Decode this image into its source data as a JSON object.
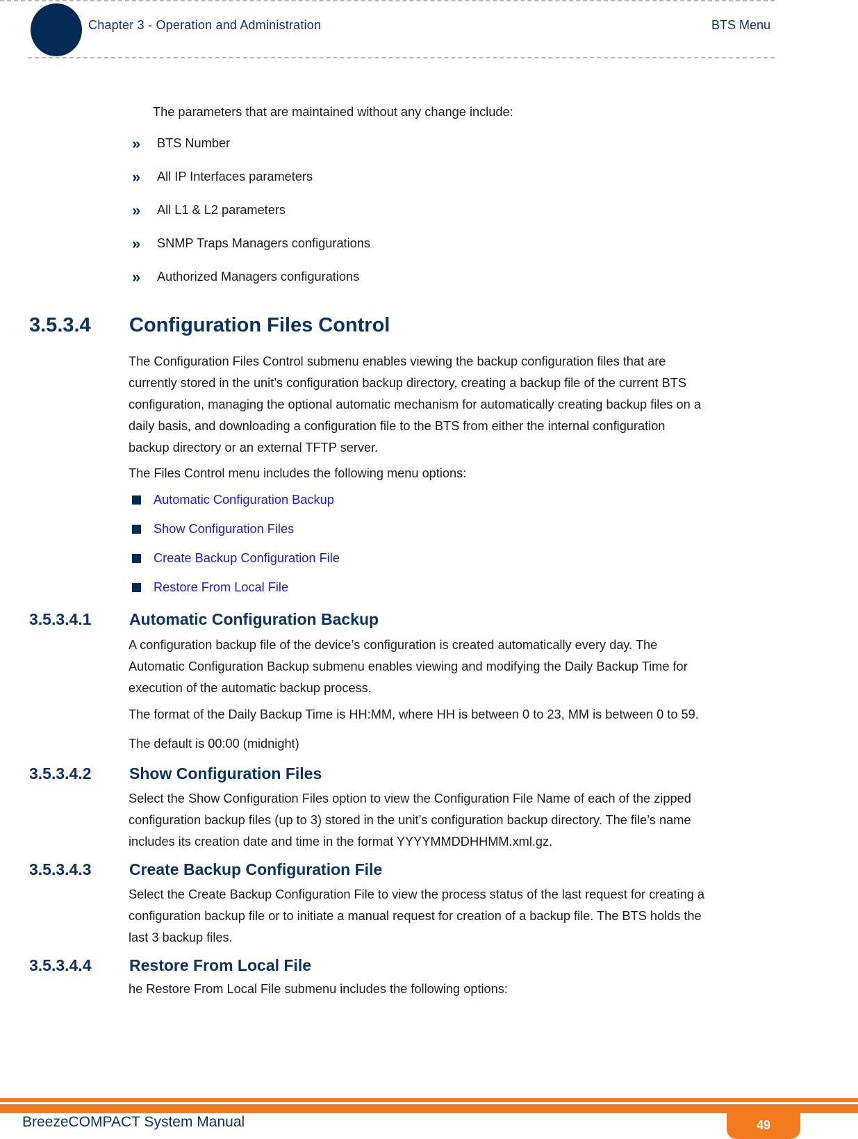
{
  "header": {
    "chapter": "Chapter 3 - Operation and Administration",
    "section": "BTS Menu"
  },
  "intro": {
    "text": "The parameters that are maintained without any change include:",
    "items": [
      "BTS Number",
      "All IP Interfaces parameters",
      "All L1 & L2 parameters",
      "SNMP Traps Managers configurations",
      "Authorized Managers configurations"
    ]
  },
  "s3534": {
    "num": "3.5.3.4",
    "title": "Configuration Files Control",
    "p1_lines": [
      "The Configuration Files Control submenu enables viewing the backup configuration files that are",
      "currently stored in the unit’s configuration backup directory, creating a backup file of the current BTS",
      "configuration, managing the optional automatic mechanism for automatically creating backup files on a",
      "daily basis, and downloading a configuration file to the BTS from either the internal configuration",
      "backup directory or an external TFTP server."
    ],
    "p2": "The Files Control menu includes the following menu options:",
    "links": [
      "Automatic Configuration Backup",
      "Show Configuration Files",
      "Create Backup Configuration File",
      "Restore From Local File"
    ]
  },
  "s35341": {
    "num": "3.5.3.4.1",
    "title": "Automatic Configuration Backup",
    "p1_lines": [
      "A configuration backup file of the device’s configuration is created automatically every day. The",
      "Automatic Configuration Backup submenu enables viewing and modifying the Daily Backup Time for",
      "execution of the automatic backup process."
    ],
    "p2": "The format of the Daily Backup Time is HH:MM, where HH is between 0 to 23, MM is between 0 to 59.",
    "p3": "The default is 00:00 (midnight)"
  },
  "s35342": {
    "num": "3.5.3.4.2",
    "title": "Show Configuration Files",
    "p1_lines": [
      "Select the Show Configuration Files option to view the Configuration File Name of each of the zipped",
      "configuration backup files (up to 3) stored in the unit’s configuration backup directory. The file’s name",
      "includes its creation date and time in the format YYYYMMDDHHMM.xml.gz."
    ]
  },
  "s35343": {
    "num": "3.5.3.4.3",
    "title": "Create Backup Configuration File",
    "p1_lines": [
      "Select the Create Backup Configuration File to view the process status of the last request for creating a",
      "configuration backup file or to initiate a manual request for creation of a backup file. The BTS holds the",
      "last 3 backup files."
    ]
  },
  "s35344": {
    "num": "3.5.3.4.4",
    "title": "Restore From Local File",
    "p1": "he Restore From Local File submenu includes the following options:"
  },
  "footer": {
    "manual_title": "BreezeCOMPACT System Manual",
    "page_number": "49"
  },
  "colors": {
    "navy": "#0d3363",
    "link": "#1a1adf",
    "orange": "#f47a20"
  }
}
